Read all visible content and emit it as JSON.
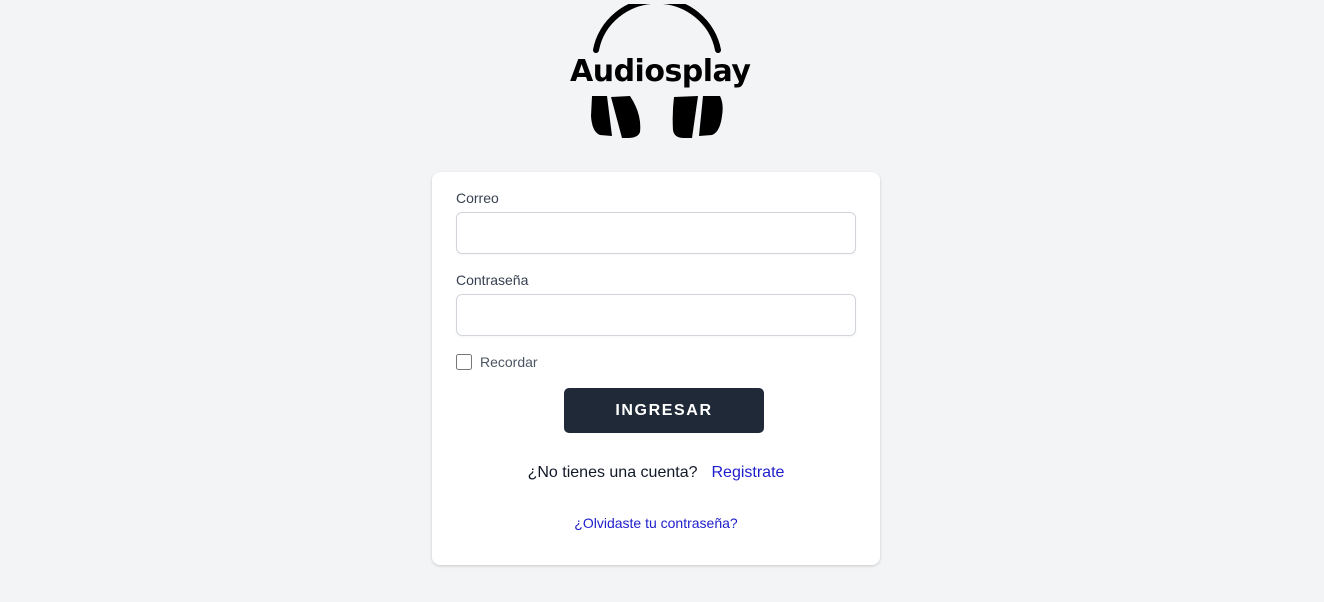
{
  "brand": {
    "name": "Audiosplay",
    "logo_icon": "headphones-icon"
  },
  "login_form": {
    "email_label": "Correo",
    "email_value": "",
    "email_placeholder": "",
    "password_label": "Contraseña",
    "password_value": "",
    "password_placeholder": "",
    "remember_label": "Recordar",
    "remember_checked": false,
    "submit_label": "INGRESAR",
    "signup_question": "¿No tienes una cuenta?",
    "signup_link": "Registrate",
    "forgot_link": "¿Olvidaste tu contraseña?"
  },
  "colors": {
    "background": "#f3f4f6",
    "card": "#ffffff",
    "button": "#1f2937",
    "link": "#1d1dcc"
  }
}
